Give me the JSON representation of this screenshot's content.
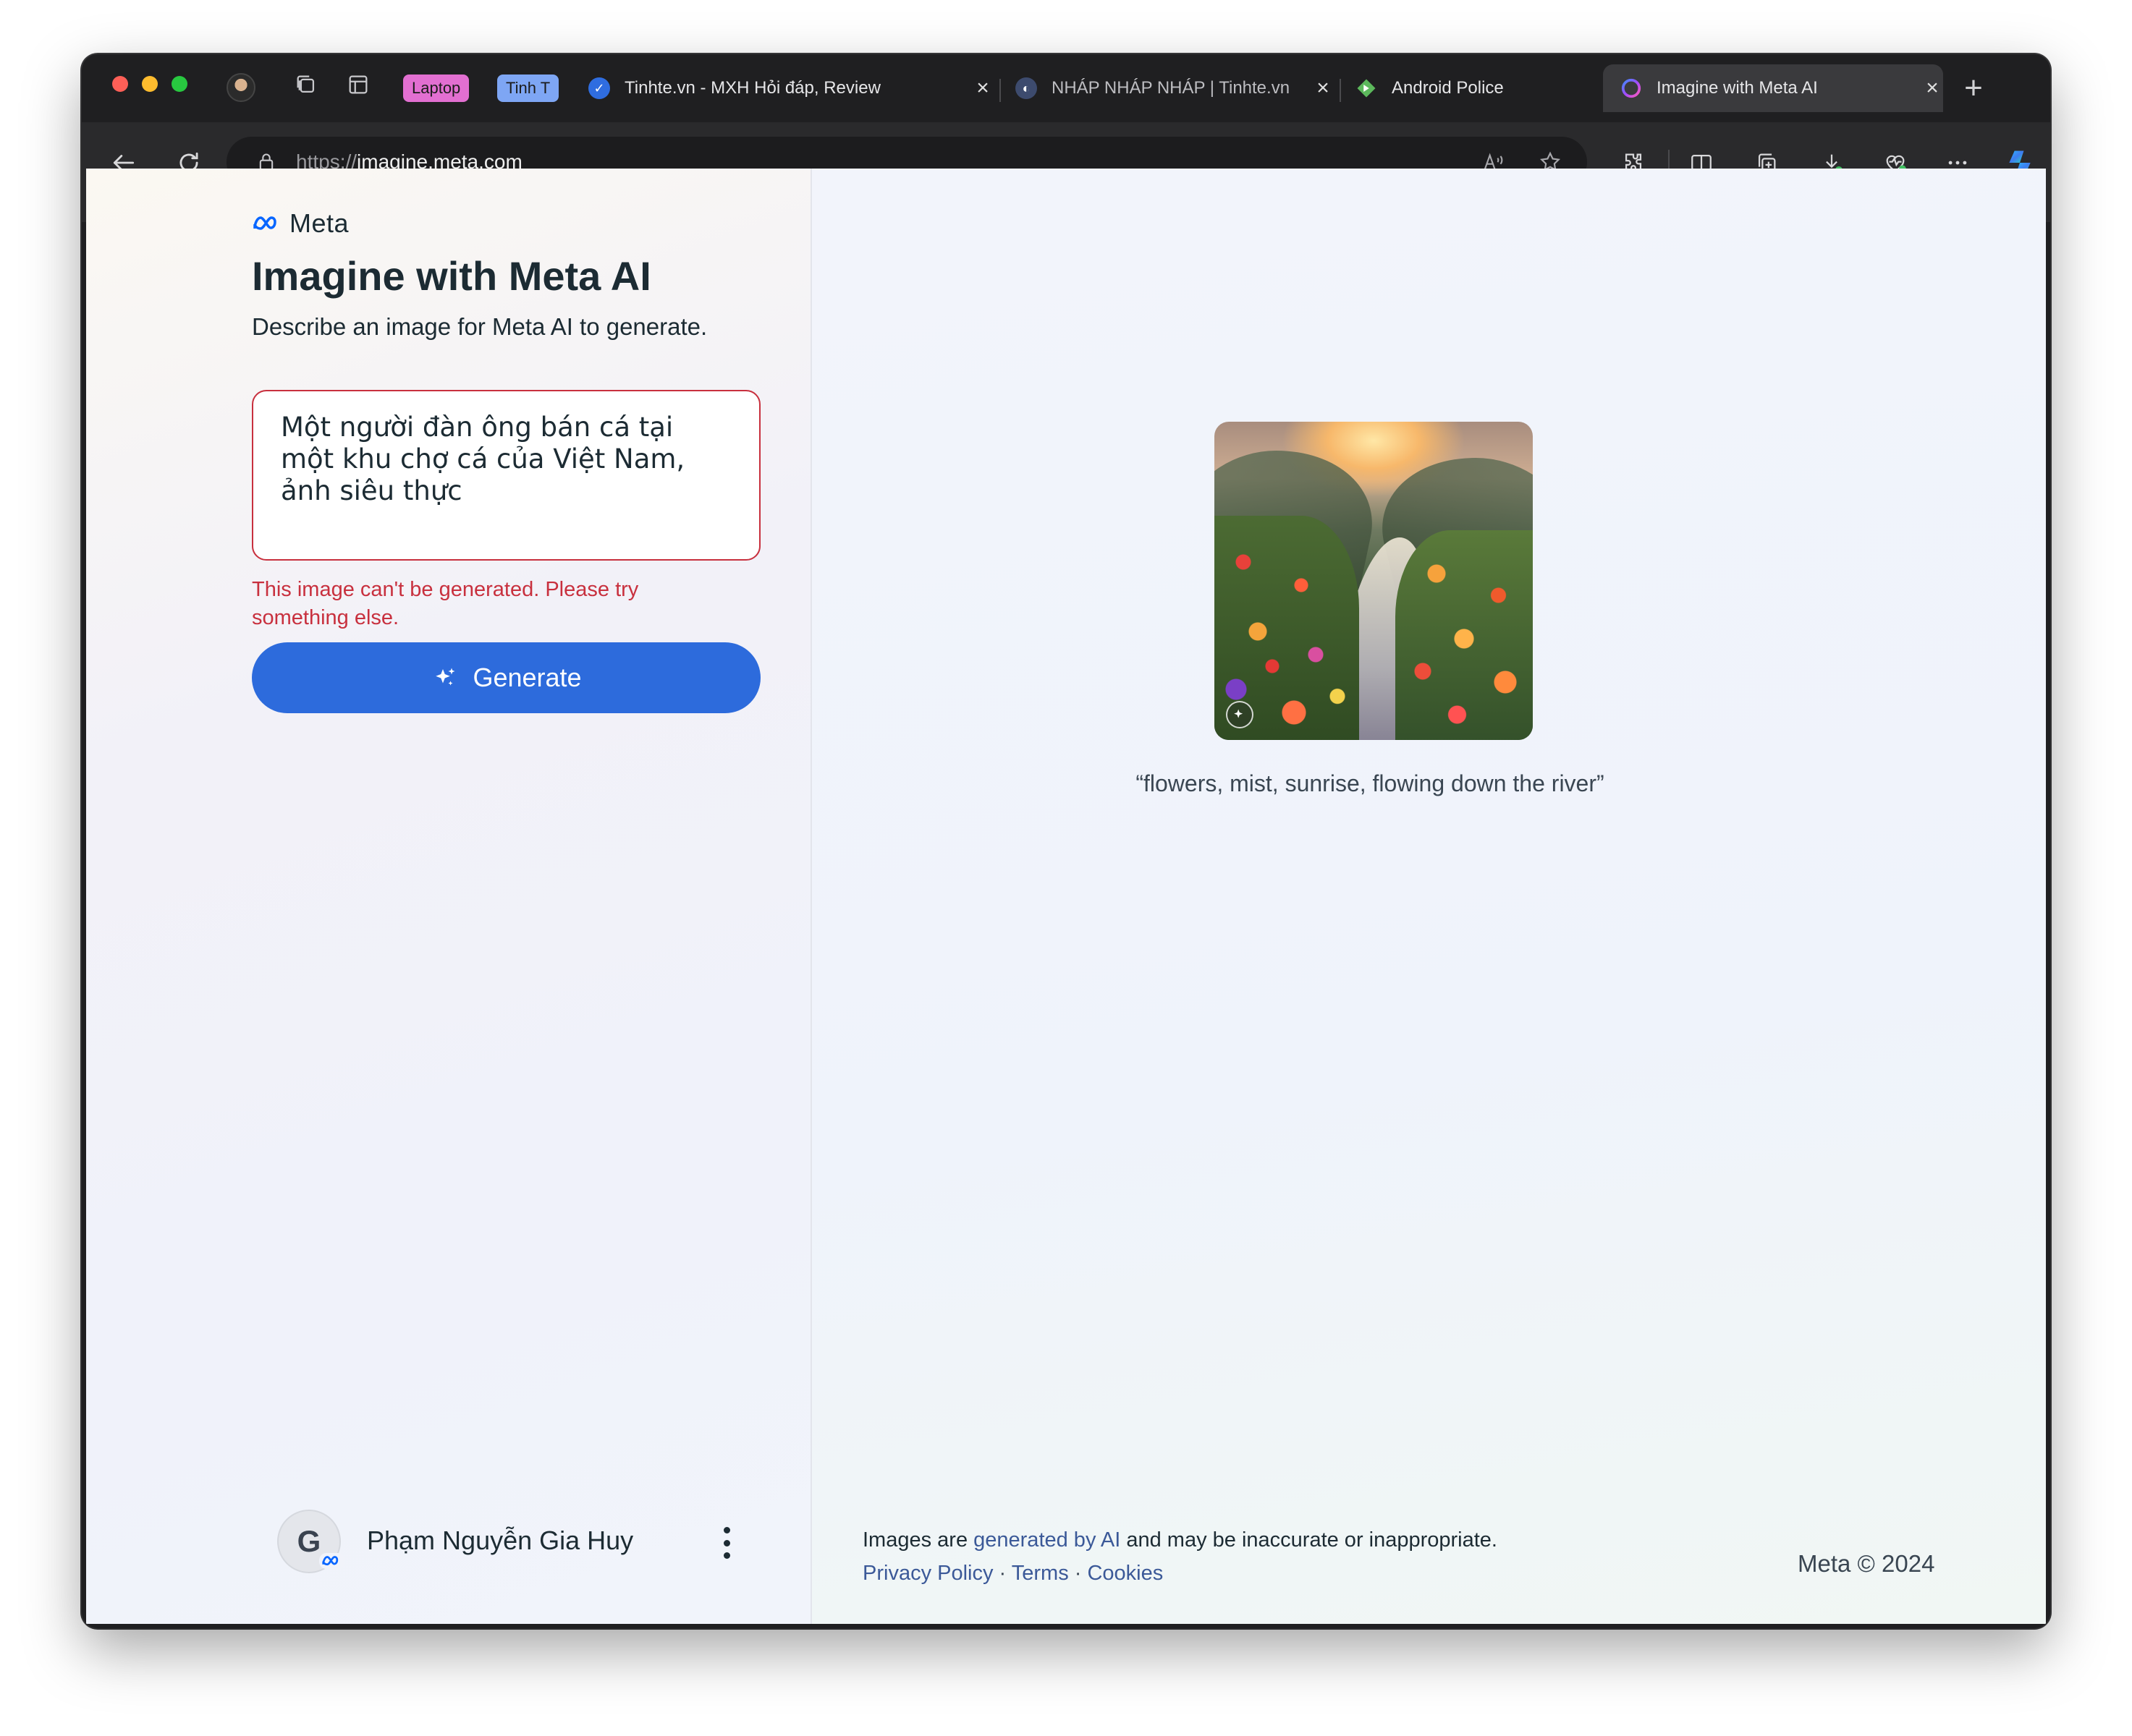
{
  "browser": {
    "tab_groups": [
      {
        "label": "Laptop",
        "color": "#e26fd1"
      },
      {
        "label": "Tinh T",
        "color": "#7ea6f4"
      }
    ],
    "tabs": [
      {
        "title": "Tinhte.vn - MXH Hỏi đáp, Review",
        "favicon": "tinhte-icon",
        "active": false
      },
      {
        "title": "NHÁP NHÁP NHÁP | Tinhte.vn",
        "favicon": "globe-icon",
        "active": false
      },
      {
        "title": "Android Police",
        "favicon": "android-police-icon",
        "active": false
      },
      {
        "title": "Imagine with Meta AI",
        "favicon": "meta-ai-icon",
        "active": true
      }
    ],
    "address": {
      "scheme": "https://",
      "host": "imagine.meta.com"
    },
    "accent_color": "#2d6bdc"
  },
  "left": {
    "brand": "Meta",
    "title": "Imagine with Meta AI",
    "subtitle": "Describe an image for Meta AI to generate.",
    "prompt_value": "Một người đàn ông bán cá tại một khu chợ cá của Việt Nam, ảnh siêu thực",
    "error": "This image can't be generated. Please try something else.",
    "generate_label": "Generate",
    "user": {
      "initial": "G",
      "name": "Phạm Nguyễn Gia Huy"
    }
  },
  "right": {
    "example_caption": "“flowers, mist, sunrise, flowing down the river”",
    "disclaimer": {
      "before": "Images are ",
      "link": "generated by AI",
      "after": " and may be inaccurate or inappropriate."
    },
    "links": [
      "Privacy Policy",
      "Terms",
      "Cookies"
    ],
    "link_separator": " · ",
    "copyright": "Meta © 2024"
  }
}
